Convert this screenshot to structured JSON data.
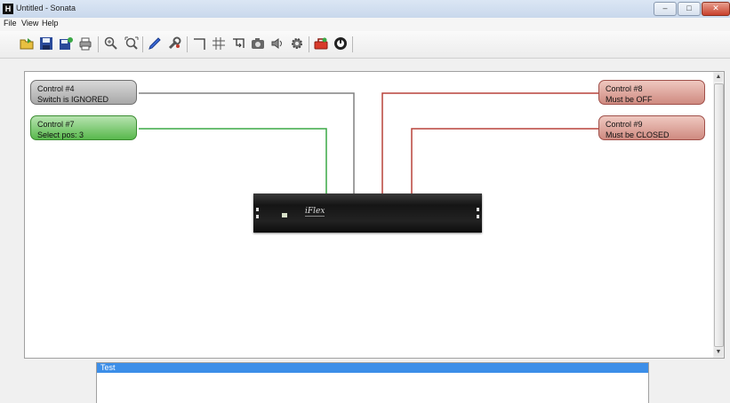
{
  "window": {
    "title": "Untitled - Sonata"
  },
  "menu": {
    "items": [
      "File",
      "View",
      "Help"
    ]
  },
  "toolbar": {
    "icons": [
      "open-folder-icon",
      "save-icon",
      "save-as-icon",
      "print-icon",
      "zoom-in-icon",
      "zoom-fit-icon",
      "pen-icon",
      "wrench-icon",
      "wire-icon",
      "grid-icon",
      "route-icon",
      "camera-icon",
      "speaker-icon",
      "gear-icon",
      "toolbox-icon",
      "power-icon"
    ]
  },
  "controls": [
    {
      "name": "Control #4",
      "status": "Switch is IGNORED",
      "color": "gray"
    },
    {
      "name": "Control #7",
      "status": "Select pos: 3",
      "color": "green"
    },
    {
      "name": "Control #8",
      "status": "Must be OFF",
      "color": "red"
    },
    {
      "name": "Control #9",
      "status": "Must be CLOSED",
      "color": "red"
    }
  ],
  "device": {
    "logo": "iFlex"
  },
  "wire_colors": {
    "gray": "#808080",
    "green": "#3aa845",
    "red": "#b8423a"
  },
  "panel": {
    "title": "Test"
  }
}
